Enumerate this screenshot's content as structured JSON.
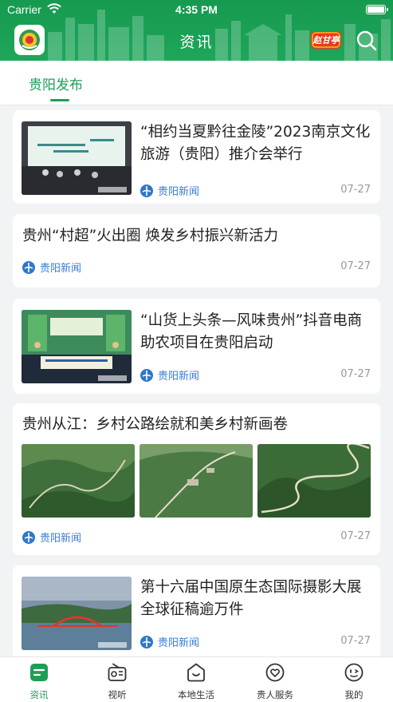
{
  "status_bar": {
    "carrier": "Carrier",
    "time": "4:35 PM"
  },
  "header": {
    "title": "资讯",
    "promo_badge": "赵甘亭"
  },
  "tabs": [
    {
      "label": "贵阳发布",
      "active": true
    }
  ],
  "articles": [
    {
      "title": "“相约当夏黔往金陵”2023南京文化旅游（贵阳）推介会举行",
      "source": "贵阳新闻",
      "date": "07-27",
      "image": "stage-event-photo"
    },
    {
      "title": "贵州“村超”火出圈 焕发乡村振兴新活力",
      "source": "贵阳新闻",
      "date": "07-27"
    },
    {
      "title": "“山货上头条—风味贵州”抖音电商助农项目在贵阳启动",
      "source": "贵阳新闻",
      "date": "07-27",
      "image": "stage-screen-photo"
    },
    {
      "title": "贵州从江：乡村公路绘就和美乡村新画卷",
      "source": "贵阳新闻",
      "date": "07-27",
      "images": [
        "mountain-road-photo-1",
        "mountain-road-photo-2",
        "mountain-road-photo-3"
      ]
    },
    {
      "title": "第十六届中国原生态国际摄影大展全球征稿逾万件",
      "source": "贵阳新闻",
      "date": "07-27",
      "image": "bridge-lake-photo"
    }
  ],
  "bottom_nav": [
    {
      "label": "资讯",
      "icon": "news-icon",
      "active": true
    },
    {
      "label": "视听",
      "icon": "radio-icon",
      "active": false
    },
    {
      "label": "本地生活",
      "icon": "smile-bag-icon",
      "active": false
    },
    {
      "label": "贵人服务",
      "icon": "heart-service-icon",
      "active": false
    },
    {
      "label": "我的",
      "icon": "profile-face-icon",
      "active": false
    }
  ],
  "colors": {
    "brand_green": "#1d9e55",
    "source_blue": "#3a7bd5",
    "date_gray": "#999999",
    "background": "#f2f3f5"
  }
}
